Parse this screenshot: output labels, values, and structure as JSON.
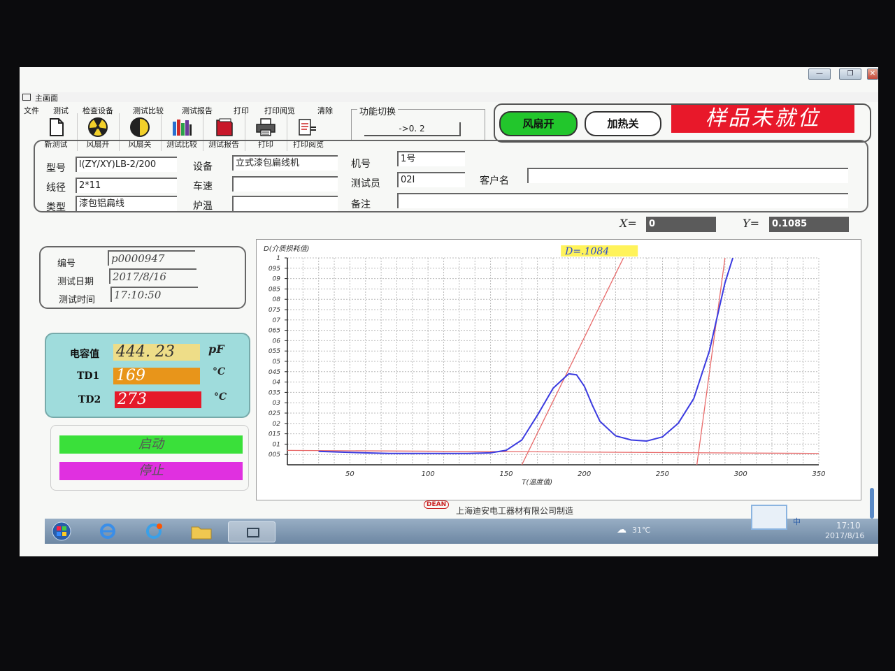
{
  "window": {
    "title": "主画面"
  },
  "menu": [
    "文件",
    "测试",
    "检查设备",
    "测试比较",
    "测试报告",
    "打印",
    "打印阅览",
    "清除"
  ],
  "toolbar": [
    {
      "label": "新测试",
      "icon": "new-document-icon"
    },
    {
      "label": "风扇开",
      "icon": "fan-on-icon"
    },
    {
      "label": "风扇关",
      "icon": "fan-off-icon"
    },
    {
      "label": "测试比较",
      "icon": "books-icon"
    },
    {
      "label": "测试报告",
      "icon": "report-icon"
    },
    {
      "label": "打印",
      "icon": "printer-icon"
    },
    {
      "label": "打印阅览",
      "icon": "print-preview-icon"
    }
  ],
  "function_switch": {
    "legend": "功能切换",
    "value": "->0. 2"
  },
  "status": {
    "fan": "风扇开",
    "heat": "加热关",
    "sample": "样品未就位",
    "fan_color": "#22c62c",
    "sample_color": "#e8182a"
  },
  "info": {
    "model_label": "型号",
    "model": "l(ZY/XY)LB-2/200",
    "wire_label": "线径",
    "wire": "2*11",
    "type_label": "类型",
    "type": "漆包铝扁线",
    "equipment_label": "设备",
    "equipment": "立式漆包扁线机",
    "speed_label": "车速",
    "speed": "",
    "furnace_label": "炉温",
    "furnace": "",
    "machine_label": "机号",
    "machine": "1号",
    "tester_label": "测试员",
    "tester": "02I",
    "note_label": "备注",
    "note": "",
    "customer_label": "客户名",
    "customer": ""
  },
  "readout": {
    "x_label": "X=",
    "x": "0",
    "y_label": "Y=",
    "y": "0.1085"
  },
  "record": {
    "id_label": "编号",
    "id": "p0000947",
    "date_label": "测试日期",
    "date": "2017/8/16",
    "time_label": "测试时间",
    "time": "17:10:50"
  },
  "measurements": {
    "cap_label": "电容值",
    "cap": "444. 23",
    "cap_unit": "pF",
    "td1_label": "TD1",
    "td1": "169",
    "td1_unit": "°C",
    "td2_label": "TD2",
    "td2": "273",
    "td2_unit": "°C",
    "cap_color": "#eedd88",
    "td1_color": "#e8951a",
    "td2_color": "#e51a2a"
  },
  "controls": {
    "start": "启动",
    "stop": "停止",
    "start_color": "#3ae03a",
    "stop_color": "#e030e0"
  },
  "footer": {
    "logo": "DEAN",
    "company": "上海迪安电工器材有限公司制造"
  },
  "tray": {
    "weather": "31℃",
    "time": "17:10",
    "date": "2017/8/16",
    "ime": "中"
  },
  "chart_data": {
    "type": "line",
    "ylabel": "D(介质损耗值)",
    "xlabel": "T(温度值)",
    "annotation": "D=.1084",
    "xlim": [
      0,
      350
    ],
    "ylim": [
      0,
      0.1
    ],
    "x_ticks": [
      "50",
      "100",
      "150",
      "200",
      "250",
      "300",
      "350"
    ],
    "y_ticks": [
      "1",
      "095",
      "09",
      "085",
      "08",
      "075",
      "07",
      "065",
      "06",
      "055",
      "05",
      "045",
      "04",
      "035",
      "03",
      "025",
      "02",
      "015",
      "01",
      "005"
    ],
    "series": [
      {
        "color": "#3b3be0",
        "x": [
          30,
          50,
          75,
          100,
          125,
          140,
          150,
          160,
          170,
          180,
          190,
          195,
          200,
          205,
          210,
          220,
          230,
          240,
          250,
          260,
          270,
          280,
          290,
          295
        ],
        "y": [
          0.0065,
          0.006,
          0.0055,
          0.0055,
          0.0055,
          0.0058,
          0.007,
          0.012,
          0.024,
          0.037,
          0.044,
          0.0435,
          0.038,
          0.029,
          0.021,
          0.014,
          0.012,
          0.0115,
          0.0135,
          0.02,
          0.032,
          0.055,
          0.088,
          0.1
        ]
      }
    ],
    "reference_lines": [
      {
        "color": "#e86a6a",
        "x": [
          160,
          225
        ],
        "y": [
          0.0,
          0.1
        ]
      },
      {
        "color": "#e86a6a",
        "x": [
          272,
          290
        ],
        "y": [
          0.0,
          0.1
        ]
      },
      {
        "color": "#e86a6a",
        "x": [
          0,
          350
        ],
        "y": [
          0.007,
          0.0055
        ]
      }
    ]
  }
}
